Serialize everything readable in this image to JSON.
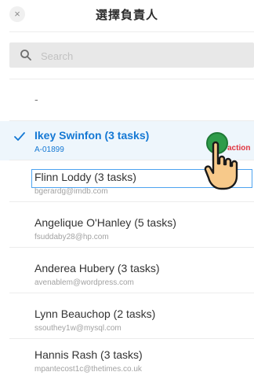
{
  "header": {
    "title": "選擇負責人",
    "close_glyph": "×",
    "close_icon": "close-icon"
  },
  "search": {
    "placeholder": "Search",
    "icon": "search-icon"
  },
  "list": {
    "placeholder_item": "-",
    "items": [
      {
        "name": "Ikey Swinfon (3 tasks)",
        "sub": "A-01899",
        "selected": true
      },
      {
        "name": "Flinn Loddy (3 tasks)",
        "sub": "bgerardg@imdb.com"
      },
      {
        "name": "Angelique O'Hanley (5 tasks)",
        "sub": "fsuddaby28@hp.com"
      },
      {
        "name": "Anderea Hubery (3 tasks)",
        "sub": "avenablem@wordpress.com"
      },
      {
        "name": "Lynn Beauchop (2 tasks)",
        "sub": "ssouthey1w@mysql.com"
      },
      {
        "name": "Hannis Rash (3 tasks)",
        "sub": "mpantecost1c@thetimes.co.uk"
      }
    ]
  },
  "overlay": {
    "action_label": "action",
    "tap_marker_color": "#2e9c4a",
    "hand_icon": "pointing-hand-icon"
  },
  "colors": {
    "accent": "#1478d4",
    "selected_bg": "#eef6fc",
    "action_text": "#e0343f"
  }
}
